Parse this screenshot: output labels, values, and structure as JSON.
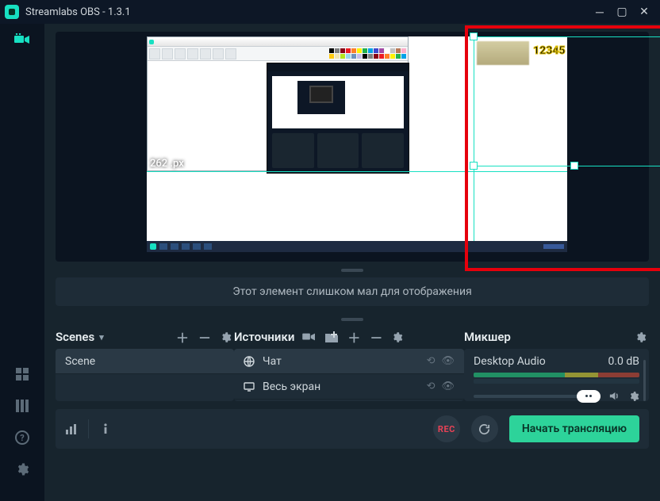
{
  "window": {
    "title": "Streamlabs OBS - 1.3.1"
  },
  "preview": {
    "px_label": "262 .px",
    "overlay_text": "12345"
  },
  "banner": {
    "text": "Этот элемент слишком мал для отображения"
  },
  "scenes": {
    "title": "Scenes",
    "items": [
      {
        "label": "Scene"
      }
    ]
  },
  "sources": {
    "title": "Источники",
    "items": [
      {
        "icon": "globe",
        "label": "Чат"
      },
      {
        "icon": "monitor",
        "label": "Весь экран"
      }
    ]
  },
  "mixer": {
    "title": "Микшер",
    "channels": [
      {
        "name": "Desktop Audio",
        "db": "0.0 dB"
      }
    ]
  },
  "bottombar": {
    "go_live": "Начать трансляцию",
    "rec": "REC"
  },
  "palette": [
    "#000",
    "#7f7f7f",
    "#880015",
    "#ed1c24",
    "#ff7f27",
    "#fff200",
    "#22b14c",
    "#00a2e8",
    "#3f48cc",
    "#a349a4",
    "#fff",
    "#c3c3c3",
    "#b97a57",
    "#ffaec9",
    "#ffc90e",
    "#efe4b0",
    "#b5e61d",
    "#99d9ea",
    "#7092be",
    "#c8bfe7",
    "#000",
    "#7f7f7f",
    "#880015",
    "#ed1c24",
    "#ff7f27",
    "#fff200",
    "#22b14c",
    "#00a2e8"
  ]
}
